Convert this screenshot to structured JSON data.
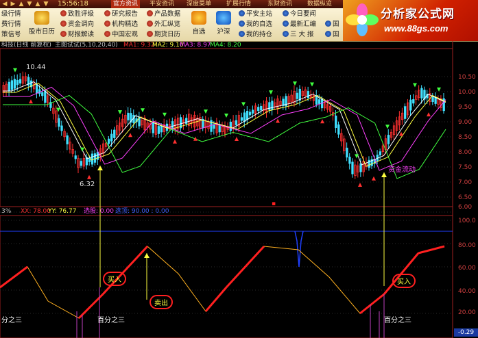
{
  "top_nav": {
    "time": "15:56:18",
    "menus": [
      "官方资讯",
      "平安资讯",
      "深度菜单",
      "扩展行情",
      "东财资讯",
      "数据纵览"
    ],
    "active_menu": "官方资讯"
  },
  "toolbar": {
    "left_col": [
      "级行情",
      "费行情",
      "策信号"
    ],
    "big_buttons": [
      "股市日历",
      "自选",
      "沪深"
    ],
    "col1": [
      "致胜评级",
      "资金调向",
      "财报解读"
    ],
    "col2": [
      "研究报告",
      "机构精选",
      "中国宏观"
    ],
    "col3": [
      "产品数据",
      "外汇纵览",
      "期货日历"
    ],
    "col4": [
      "平安主站",
      "我的自选",
      "我的持仓"
    ],
    "col5": [
      "今日要闻",
      "最新汇编",
      "三 大 报"
    ],
    "col6": [
      "国",
      "国",
      ""
    ]
  },
  "logo": {
    "title": "分析家公式网",
    "url": "www.88gs.com"
  },
  "main_chart": {
    "header_label": "科技(日线 前复权)",
    "indicator_name": "主图试试(5,10,20,40)",
    "ma_values": [
      {
        "label": "MA1: 9.32",
        "color": "#ff3030"
      },
      {
        "label": "MA2: 9.10",
        "color": "#ffff40"
      },
      {
        "label": "MA3: 8.97",
        "color": "#ff40ff"
      },
      {
        "label": "MA4: 8.20",
        "color": "#40ff40"
      }
    ],
    "price_high_label": "10.44",
    "price_low_label": "6.32",
    "annotation_label": "资金流动",
    "y_ticks": [
      "10.50",
      "10.00",
      "9.50",
      "9.00",
      "8.50",
      "8.00",
      "7.50",
      "7.00",
      "6.50",
      "6.00"
    ]
  },
  "sub_chart": {
    "pct_label": "3%",
    "values": [
      {
        "label": "XX: 78.00",
        "color": "#ff3030"
      },
      {
        "label": "YY: 76.77",
        "color": "#ffff40"
      },
      {
        "label": "选股: 0.00",
        "color": "#ff40ff"
      },
      {
        "label": "选顶: 90.00 : 0.00",
        "color": "#4060ff"
      }
    ],
    "y_ticks": [
      "100.0",
      "80.00",
      "60.00",
      "40.00",
      "20.00"
    ],
    "buy_label": "买入",
    "sell_label": "卖出",
    "buy_label_2": "买入",
    "pct_text_1": "分之三",
    "pct_text_2": "百分之三",
    "pct_text_3": "百分之三",
    "corner_value": "-0.29"
  }
}
